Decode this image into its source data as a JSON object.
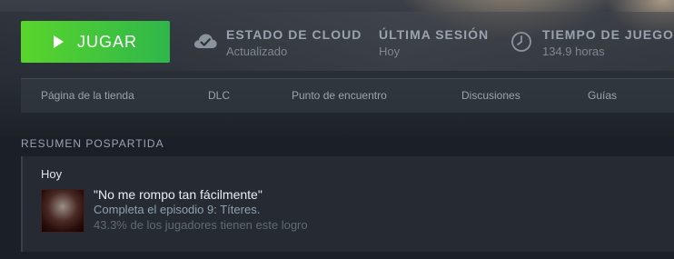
{
  "header": {
    "play_label": "JUGAR",
    "play_icon": "play-icon",
    "stats": [
      {
        "icon": "cloud-check-icon",
        "title": "ESTADO DE CLOUD",
        "value": "Actualizado"
      },
      {
        "icon": "",
        "title": "ÚLTIMA SESIÓN",
        "value": "Hoy"
      },
      {
        "icon": "clock-icon",
        "title": "TIEMPO DE JUEGO",
        "value": "134.9 horas"
      }
    ],
    "accent_color": "#4fcb38"
  },
  "nav": {
    "tabs": [
      {
        "label": "Página de la tienda"
      },
      {
        "label": "DLC"
      },
      {
        "label": "Punto de encuentro"
      },
      {
        "label": "Discusiones"
      },
      {
        "label": "Guías"
      }
    ]
  },
  "summary": {
    "section_title": "RESUMEN POSPARTIDA",
    "day": "Hoy",
    "achievement": {
      "title": "\"No me rompo tan fácilmente\"",
      "description": "Completa el episodio 9: Títeres.",
      "percent_text": "43.3% de los jugadores tienen este logro"
    }
  }
}
